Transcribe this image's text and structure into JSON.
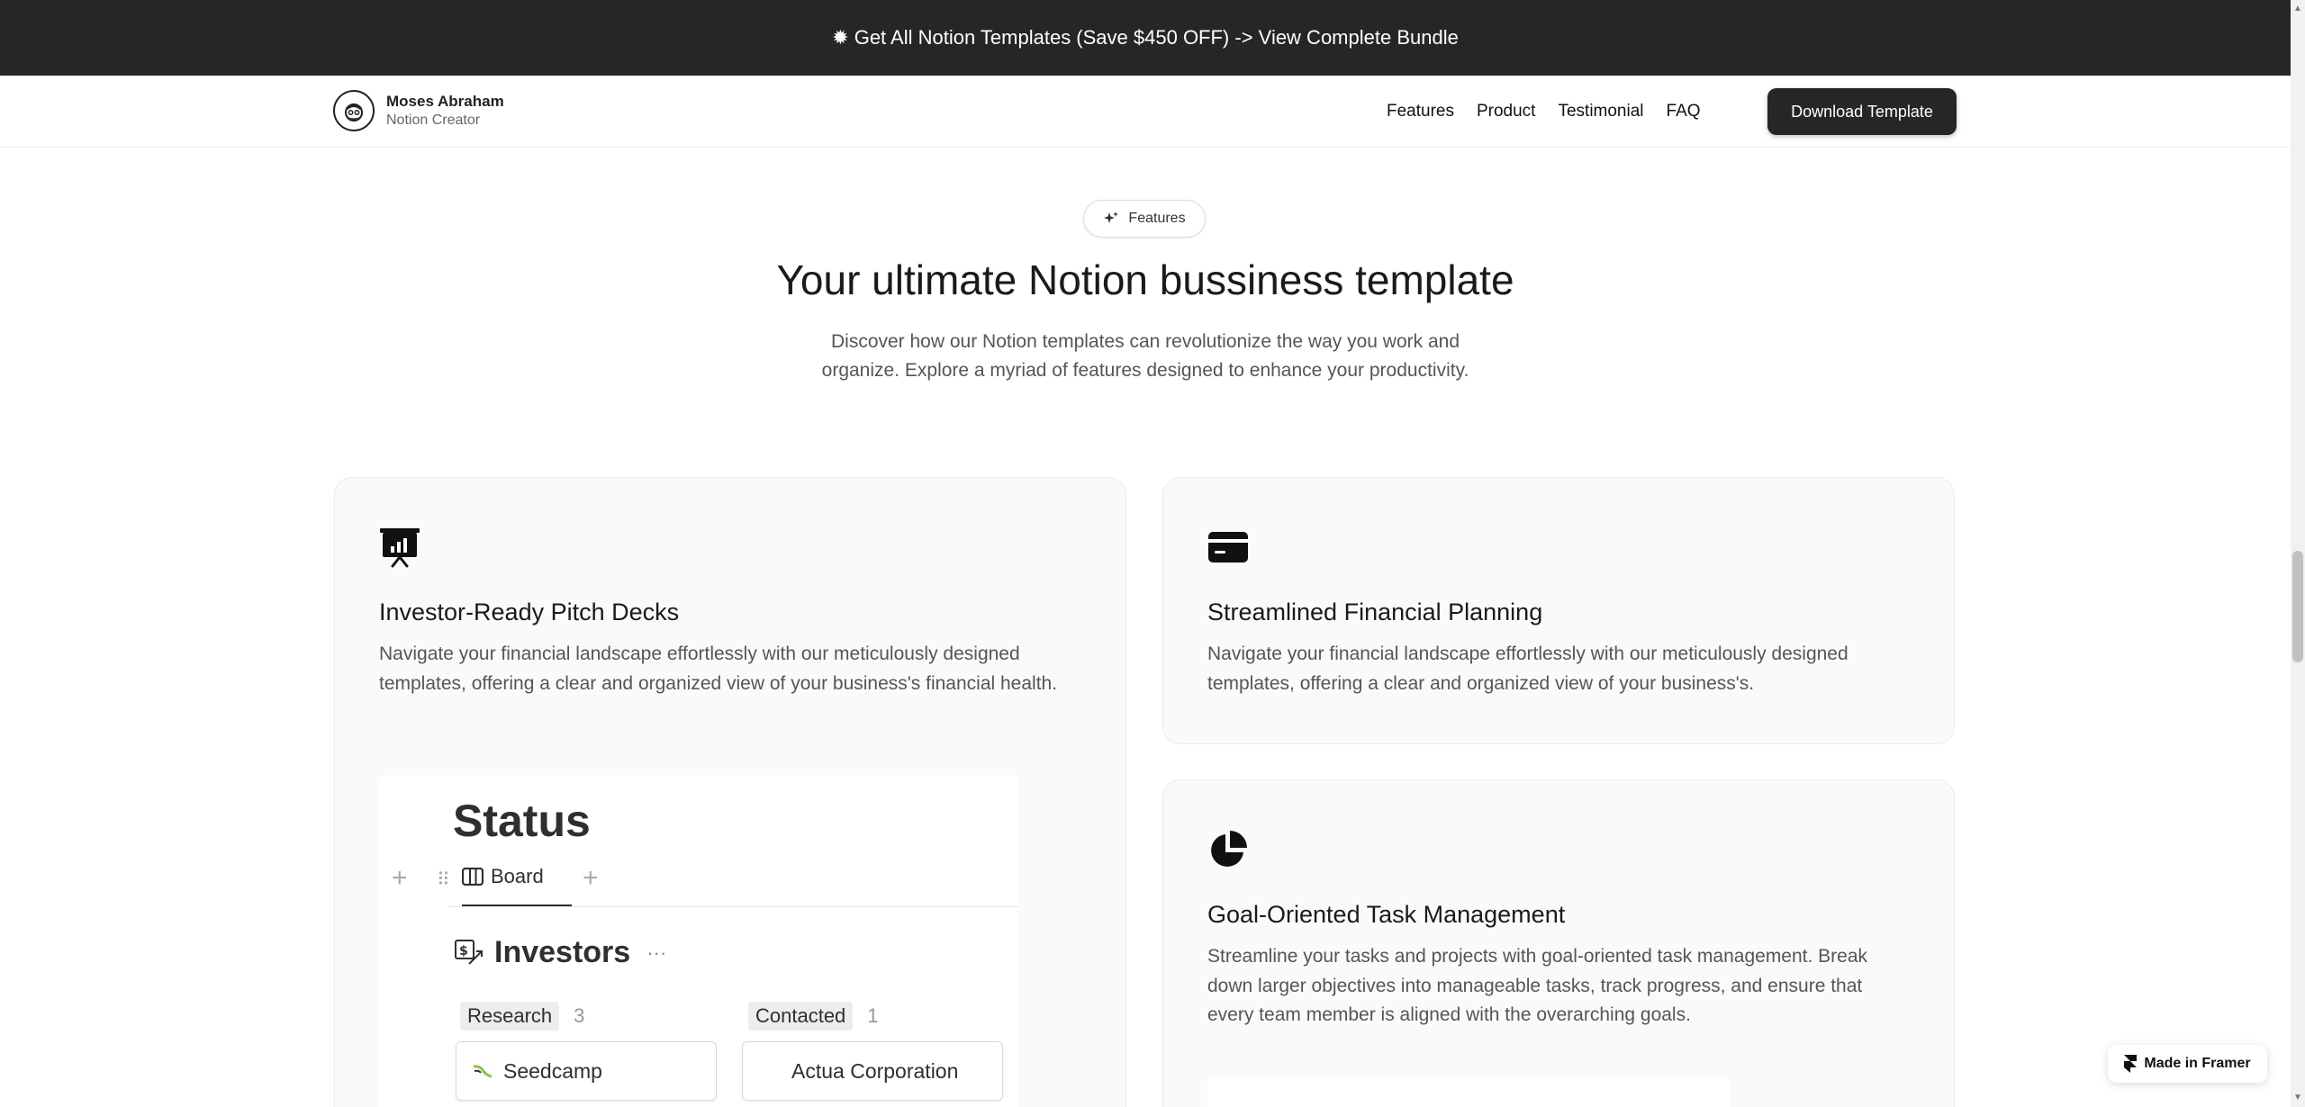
{
  "promo": {
    "icon": "sparkle-icon",
    "text": "✹ Get All Notion Templates (Save $450 OFF) -> View Complete Bundle"
  },
  "nav": {
    "brand_name": "Moses Abraham",
    "brand_sub": "Notion Creator",
    "links": [
      "Features",
      "Product",
      "Testimonial",
      "FAQ"
    ],
    "cta": "Download Template"
  },
  "hero": {
    "pill_label": "Features",
    "title": "Your ultimate Notion bussiness template",
    "description": "Discover how our Notion templates can revolutionize the way you work and organize. Explore a myriad of features designed to enhance your productivity."
  },
  "cards": [
    {
      "icon": "presentation-chart-icon",
      "title": "Investor-Ready Pitch Decks",
      "text": "Navigate your financial landscape effortlessly with our meticulously designed templates, offering a clear and organized view of your business's financial health."
    },
    {
      "icon": "credit-card-icon",
      "title": "Streamlined Financial Planning",
      "text": "Navigate your financial landscape effortlessly with our meticulously designed templates, offering a clear and organized view of your business's."
    },
    {
      "icon": "pie-chart-icon",
      "title": "Goal-Oriented Task Management",
      "text": "Streamline your tasks and projects with goal-oriented task management. Break down larger objectives into manageable tasks, track progress, and ensure that every team member is aligned with the overarching goals."
    }
  ],
  "preview": {
    "title": "Status",
    "tab": "Board",
    "database": "Investors",
    "columns": [
      {
        "label": "Research",
        "count": "3",
        "first_card": "Seedcamp"
      },
      {
        "label": "Contacted",
        "count": "1",
        "first_card": "Actua Corporation"
      }
    ]
  },
  "badge": {
    "text": "Made in Framer"
  }
}
